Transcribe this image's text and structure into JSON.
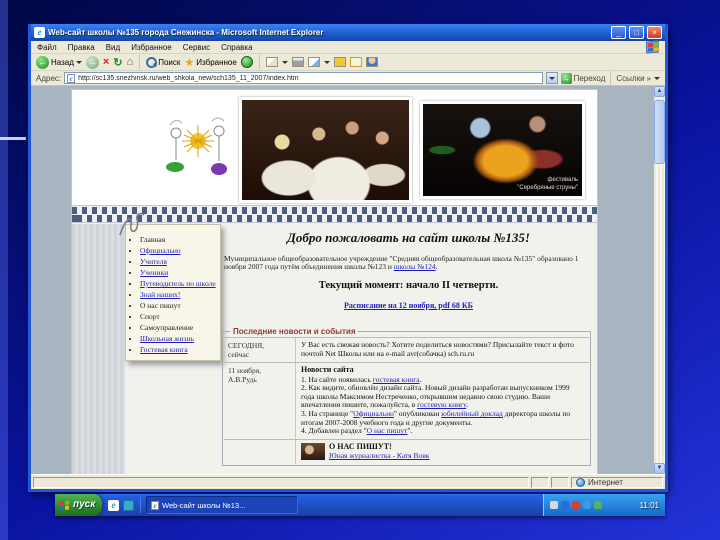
{
  "window": {
    "title": "Web-сайт школы №135 города Снежинска - Microsoft Internet Explorer",
    "menu_items": [
      "Файл",
      "Правка",
      "Вид",
      "Избранное",
      "Сервис",
      "Справка"
    ],
    "toolbar": {
      "back_label": "Назад",
      "search_label": "Поиск",
      "favorites_label": "Избранное"
    },
    "address": {
      "label": "Адрес:",
      "url": "http://sc135.snezhinsk.ru/web_shkola_new/sch135_11_2007/index.htm",
      "go_label": "Переход",
      "links_label": "Ссылки"
    },
    "status_zone": "Интернет"
  },
  "page": {
    "photo_caption_line1": "фестиваль",
    "photo_caption_line2": "\"Серебряные струны\"",
    "sidebar_links": [
      "Главная",
      "Официально",
      "Учителя",
      "Ученики",
      "Путеводитель по школе",
      "Знай наших!",
      "О нас пишут",
      "Спорт",
      "Самоуправление",
      "Школьная жизнь",
      "Гостевая книга"
    ],
    "heading": "Добро пожаловать на сайт школы №135!",
    "intro_text": "Муниципальное общеобразовательное учреждение \"Средняя общеобразовательная школа №135\" образовано 1 ноября 2007 года путём объединения школы №123 и ",
    "intro_link": "школы №124",
    "intro_tail": ".",
    "current_moment": "Текущий момент: начало II четверти.",
    "schedule_link": "Расписание на 12 ноября, pdf 68 КБ",
    "news": {
      "legend": "Последние новости и события",
      "row1": {
        "when_line1": "СЕГОДНЯ,",
        "when_line2": "сейчас",
        "text": "У Вас есть свежая новость? Хотите поделиться новостями? Присылайте текст и фото почтой Net Школы или на e-mail avr(собачка) sch.ru.ru"
      },
      "row2": {
        "when": "11 ноября, А.В.Рудь",
        "title": "Новости сайта",
        "item1_pre": "1. На сайте появилась ",
        "item1_link": "гостевая книга",
        "item1_tail": ".",
        "item2_pre": "2. Как видите, обновлён дизайн сайта. Новый дизайн разработан выпускником 1999 года школы Максимом Нестреченко, открывшим недавно свою студию. Ваши впечатления пишите, пожалуйста, в ",
        "item2_link": "гостевую книгу",
        "item2_tail": ".",
        "item3_pre": "3. На странице \"",
        "item3_link1": "Официально",
        "item3_mid": "\" опубликован ",
        "item3_link2": "юбилейный доклад",
        "item3_tail": " директора школы по итогам 2007-2008 учебного года и другие документы.",
        "item4_pre": "4. Добавлен раздел \"",
        "item4_link": "О нас пишут",
        "item4_tail": "\"."
      },
      "row3": {
        "title": "О НАС ПИШУТ!",
        "link": "Юная журналистка - Катя Вовк"
      }
    }
  },
  "taskbar": {
    "start_label": "пуск",
    "task_label": "Web-сайт школы №13...",
    "clock": "11:01"
  },
  "icons": {
    "back": "←",
    "forward": "→",
    "stop": "×",
    "refresh": "↻",
    "home": "⌂",
    "favorites": "★",
    "links_chevron": "»",
    "scroll_up": "▲",
    "scroll_down": "▼",
    "ie": "e",
    "minimize": "_",
    "maximize": "□",
    "close": "×",
    "go": "→"
  }
}
